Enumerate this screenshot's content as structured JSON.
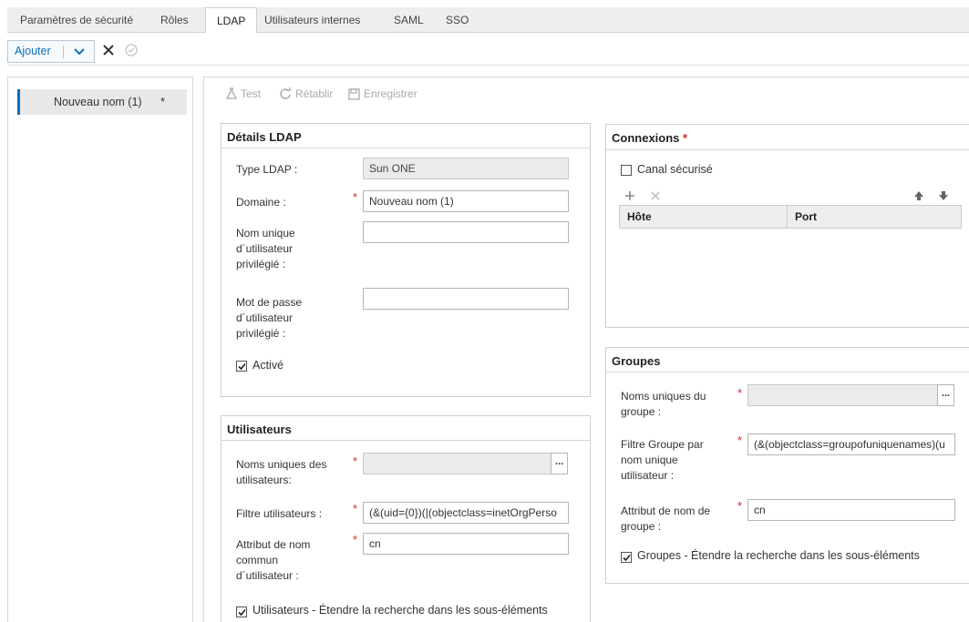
{
  "tabs": [
    {
      "label": "Paramètres de sécurité"
    },
    {
      "label": "Rôles"
    },
    {
      "label": "LDAP"
    },
    {
      "label": "Utilisateurs internes"
    },
    {
      "label": "SAML"
    },
    {
      "label": "SSO"
    }
  ],
  "toolbar": {
    "add_label": "Ajouter"
  },
  "left_list": {
    "item_label": "Nouveau nom (1)",
    "item_marker": "*"
  },
  "actions": {
    "test": "Test",
    "reset": "Rétablir",
    "save": "Enregistrer"
  },
  "ldap": {
    "title": "Détails LDAP",
    "type_label": "Type LDAP :",
    "type_value": "Sun ONE",
    "domain_label": "Domaine :",
    "domain_value": "Nouveau nom (1)",
    "priv_dn_label": [
      "Nom unique",
      "d´utilisateur",
      "privilégié :"
    ],
    "priv_pw_label": [
      "Mot de passe",
      "d´utilisateur",
      "privilégié :"
    ],
    "active_label": "Activé",
    "active_checked": true
  },
  "users": {
    "title": "Utilisateurs",
    "dn_label": [
      "Noms uniques des",
      "utilisateurs:"
    ],
    "dn_browse": "...",
    "filter_label": "Filtre utilisateurs :",
    "filter_value": "(&(uid={0})(|(objectclass=inetOrgPerso",
    "cn_label": [
      "Attribut de nom",
      "commun",
      "d´utilisateur :"
    ],
    "cn_value": "cn",
    "subtree_label": "Utilisateurs - Étendre la recherche dans les sous-éléments",
    "subtree_checked": true
  },
  "connections": {
    "title": "Connexions",
    "secure_label": "Canal sécurisé",
    "secure_checked": false,
    "col_host": "Hôte",
    "col_port": "Port"
  },
  "groups": {
    "title": "Groupes",
    "dn_label": [
      "Noms uniques du",
      "groupe :"
    ],
    "dn_browse": "...",
    "filter_label": [
      "Filtre Groupe par",
      "nom unique",
      "utilisateur :"
    ],
    "filter_value": "(&(objectclass=groupofuniquenames)(u",
    "name_label": [
      "Attribut de nom de",
      "groupe :"
    ],
    "name_value": "cn",
    "subtree_label": "Groupes - Étendre la recherche dans les sous-éléments",
    "subtree_checked": true
  },
  "required_marker": "*",
  "colors": {
    "accent": "#0a6ebd",
    "required": "#d9262c"
  }
}
